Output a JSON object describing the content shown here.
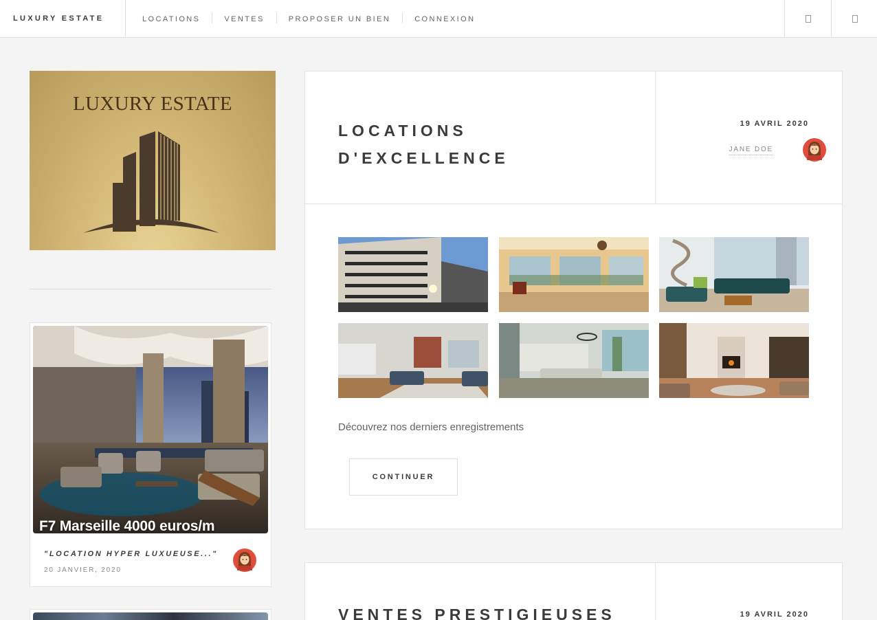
{
  "header": {
    "brand": "LUXURY ESTATE",
    "nav": [
      {
        "label": "LOCATIONS"
      },
      {
        "label": "VENTES"
      },
      {
        "label": "PROPOSER UN BIEN"
      },
      {
        "label": "CONNEXION"
      }
    ],
    "icons": [
      "search-icon",
      "menu-icon"
    ]
  },
  "sidebar": {
    "logo_text": "LUXURY ESTATE",
    "featured": {
      "caption": "F7 Marseille 4000 euros/m",
      "quote": "\"LOCATION HYPER LUXUEUSE...\"",
      "date": "20 JANVIER, 2020"
    }
  },
  "posts": [
    {
      "title": "LOCATIONS D'EXCELLENCE",
      "date": "19 AVRIL 2020",
      "author": "JANE DOE",
      "description": "Découvrez nos derniers enregistrements",
      "button": "CONTINUER",
      "gallery": [
        "building-exterior",
        "sunny-living-room",
        "loft-with-staircase",
        "brick-loft-kitchen",
        "open-plan-lounge",
        "fireplace-lounge"
      ]
    },
    {
      "title": "VENTES PRESTIGIEUSES",
      "date": "19 AVRIL 2020"
    }
  ],
  "colors": {
    "background": "#f4f4f4",
    "text": "#3c3b3b",
    "muted": "#8a8a8a",
    "border": "#e2e2e2",
    "logo_gold": "#d4b877",
    "logo_brown": "#4a3219"
  }
}
